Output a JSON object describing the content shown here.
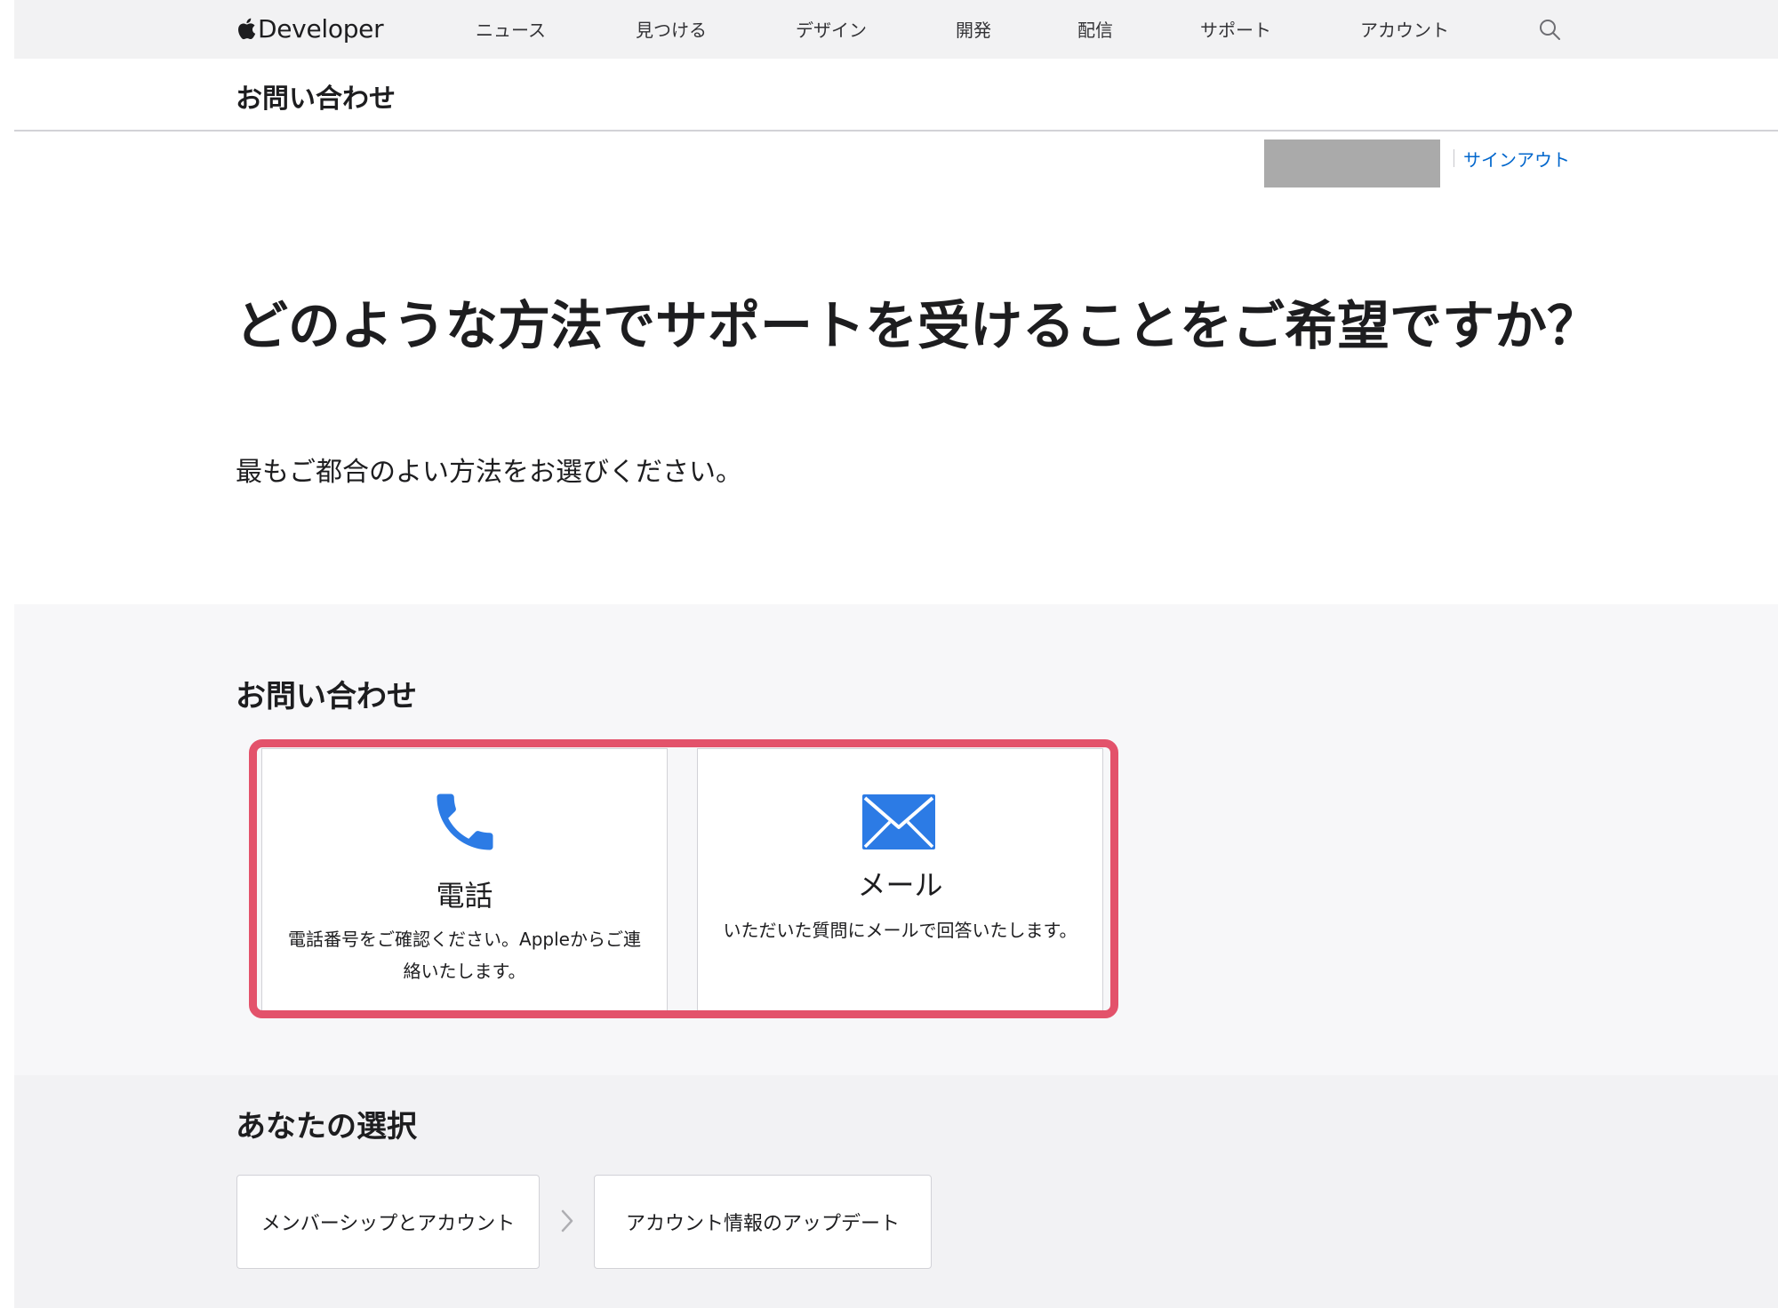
{
  "globalnav": {
    "brand": "Developer",
    "items": [
      "ニュース",
      "見つける",
      "デザイン",
      "開発",
      "配信",
      "サポート",
      "アカウント"
    ]
  },
  "localnav": {
    "title": "お問い合わせ"
  },
  "account": {
    "signout": "サインアウト"
  },
  "hero": {
    "title": "どのような方法でサポートを受けることをご希望ですか？",
    "subtitle": "最もご都合のよい方法をお選びください。"
  },
  "contact": {
    "heading": "お問い合わせ",
    "options": [
      {
        "icon": "phone-icon",
        "title": "電話",
        "description": "電話番号をご確認ください。Appleからご連絡いたします。"
      },
      {
        "icon": "envelope-icon",
        "title": "メール",
        "description": "いただいた質問にメールで回答いたします。"
      }
    ]
  },
  "selection": {
    "heading": "あなたの選択",
    "path": [
      "メンバーシップとアカウント",
      "アカウント情報のアップデート"
    ]
  },
  "colors": {
    "accent_link": "#0066cc",
    "icon_blue": "#2c7be5",
    "highlight": "#e3526b"
  }
}
